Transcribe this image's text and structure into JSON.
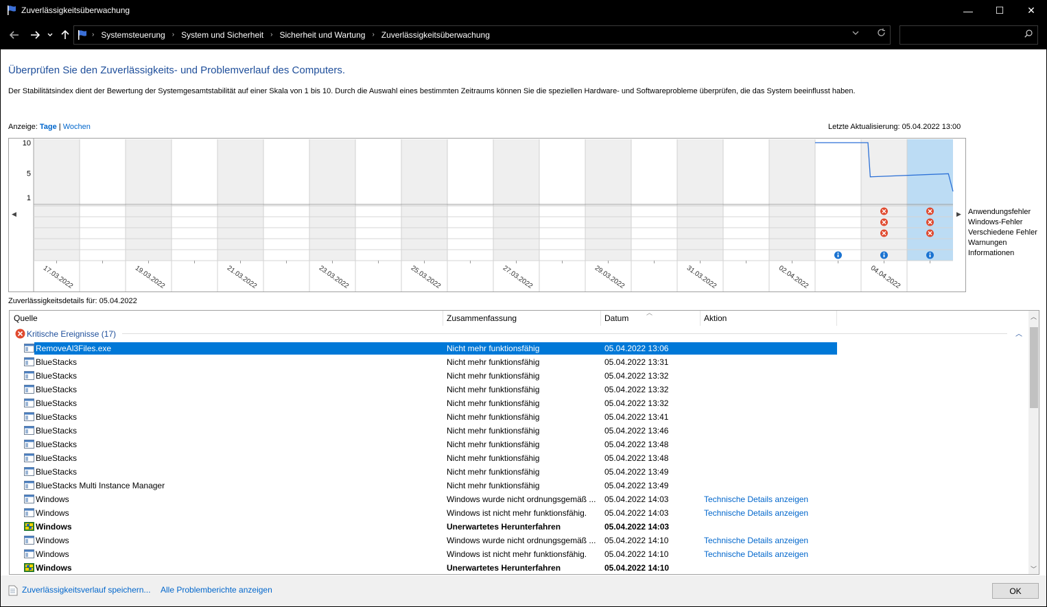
{
  "window": {
    "title": "Zuverlässigkeitsüberwachung",
    "minimize": "—",
    "maximize": "☐",
    "close": "✕"
  },
  "address": {
    "crumbs": [
      "Systemsteuerung",
      "System und Sicherheit",
      "Sicherheit und Wartung",
      "Zuverlässigkeitsüberwachung"
    ],
    "search_placeholder": ""
  },
  "page": {
    "heading": "Überprüfen Sie den Zuverlässigkeits- und Problemverlauf des Computers.",
    "description": "Der Stabilitätsindex dient der Bewertung der Systemgesamtstabilität auf einer Skala von 1 bis 10. Durch die Auswahl eines bestimmten Zeitraums können Sie die speziellen Hardware- und Softwareprobleme überprüfen, die das System beeinflusst haben.",
    "view_label": "Anzeige:",
    "view_days": "Tage",
    "view_sep": "|",
    "view_weeks": "Wochen",
    "last_update": "Letzte Aktualisierung: 05.04.2022 13:00",
    "details_label": "Zuverlässigkeitsdetails für: 05.04.2022"
  },
  "chart_data": {
    "type": "line",
    "title": "",
    "ylim": [
      1,
      10
    ],
    "y_ticks": [
      10,
      5,
      1
    ],
    "columns": 20,
    "selected_column": 19,
    "date_labels": [
      "17.03.2022",
      "19.03.2022",
      "21.03.2022",
      "23.03.2022",
      "25.03.2022",
      "27.03.2022",
      "29.03.2022",
      "31.03.2022",
      "02.04.2022",
      "04.04.2022"
    ],
    "series": [
      {
        "values": [
          {
            "x": 17.0,
            "y": 10.0
          },
          {
            "x": 18.15,
            "y": 10.0
          },
          {
            "x": 18.2,
            "y": 4.4
          },
          {
            "x": 19.9,
            "y": 4.9
          },
          {
            "x": 20.0,
            "y": 2.0
          }
        ]
      }
    ],
    "event_rows": [
      "Anwendungsfehler",
      "Windows-Fehler",
      "Verschiedene Fehler",
      "Warnungen",
      "Informationen"
    ],
    "events": [
      {
        "row": 0,
        "col": 18,
        "kind": "error"
      },
      {
        "row": 1,
        "col": 18,
        "kind": "error"
      },
      {
        "row": 2,
        "col": 18,
        "kind": "error"
      },
      {
        "row": 0,
        "col": 19,
        "kind": "error"
      },
      {
        "row": 1,
        "col": 19,
        "kind": "error"
      },
      {
        "row": 2,
        "col": 19,
        "kind": "error"
      },
      {
        "row": 4,
        "col": 17,
        "kind": "info"
      },
      {
        "row": 4,
        "col": 18,
        "kind": "info"
      },
      {
        "row": 4,
        "col": 19,
        "kind": "info"
      }
    ]
  },
  "list": {
    "headers": {
      "source": "Quelle",
      "summary": "Zusammenfassung",
      "date": "Datum",
      "action": "Aktion"
    },
    "group": "Kritische Ereignisse (17)",
    "rows": [
      {
        "icon": "app",
        "source": "RemoveAl3Files.exe",
        "summary": "Nicht mehr funktionsfähig",
        "date": "05.04.2022 13:06",
        "action": "",
        "selected": true
      },
      {
        "icon": "app",
        "source": "BlueStacks",
        "summary": "Nicht mehr funktionsfähig",
        "date": "05.04.2022 13:31",
        "action": ""
      },
      {
        "icon": "app",
        "source": "BlueStacks",
        "summary": "Nicht mehr funktionsfähig",
        "date": "05.04.2022 13:32",
        "action": ""
      },
      {
        "icon": "app",
        "source": "BlueStacks",
        "summary": "Nicht mehr funktionsfähig",
        "date": "05.04.2022 13:32",
        "action": ""
      },
      {
        "icon": "app",
        "source": "BlueStacks",
        "summary": "Nicht mehr funktionsfähig",
        "date": "05.04.2022 13:32",
        "action": ""
      },
      {
        "icon": "app",
        "source": "BlueStacks",
        "summary": "Nicht mehr funktionsfähig",
        "date": "05.04.2022 13:41",
        "action": ""
      },
      {
        "icon": "app",
        "source": "BlueStacks",
        "summary": "Nicht mehr funktionsfähig",
        "date": "05.04.2022 13:46",
        "action": ""
      },
      {
        "icon": "app",
        "source": "BlueStacks",
        "summary": "Nicht mehr funktionsfähig",
        "date": "05.04.2022 13:48",
        "action": ""
      },
      {
        "icon": "app",
        "source": "BlueStacks",
        "summary": "Nicht mehr funktionsfähig",
        "date": "05.04.2022 13:48",
        "action": ""
      },
      {
        "icon": "app",
        "source": "BlueStacks",
        "summary": "Nicht mehr funktionsfähig",
        "date": "05.04.2022 13:49",
        "action": ""
      },
      {
        "icon": "app",
        "source": "BlueStacks Multi Instance Manager",
        "summary": "Nicht mehr funktionsfähig",
        "date": "05.04.2022 13:49",
        "action": ""
      },
      {
        "icon": "app",
        "source": "Windows",
        "summary": "Windows wurde nicht ordnungsgemäß ...",
        "date": "05.04.2022 14:03",
        "action": "Technische Details anzeigen"
      },
      {
        "icon": "app",
        "source": "Windows",
        "summary": "Windows ist nicht mehr funktionsfähig.",
        "date": "05.04.2022 14:03",
        "action": "Technische Details anzeigen"
      },
      {
        "icon": "windows",
        "source": "Windows",
        "summary": "Unerwartetes Herunterfahren",
        "date": "05.04.2022 14:03",
        "action": "",
        "bold": true
      },
      {
        "icon": "app",
        "source": "Windows",
        "summary": "Windows wurde nicht ordnungsgemäß ...",
        "date": "05.04.2022 14:10",
        "action": "Technische Details anzeigen"
      },
      {
        "icon": "app",
        "source": "Windows",
        "summary": "Windows ist nicht mehr funktionsfähig.",
        "date": "05.04.2022 14:10",
        "action": "Technische Details anzeigen"
      },
      {
        "icon": "windows",
        "source": "Windows",
        "summary": "Unerwartetes Herunterfahren",
        "date": "05.04.2022 14:10",
        "action": "",
        "bold": true
      }
    ]
  },
  "footer": {
    "save_link": "Zuverlässigkeitsverlauf speichern...",
    "reports_link": "Alle Problemberichte anzeigen",
    "ok": "OK"
  },
  "colors": {
    "accent": "#0078d7",
    "heading": "#1e4e9a",
    "link": "#0066cc",
    "selected_column": "#bcdcf4",
    "error": "#e04a2f",
    "info": "#1a73d1"
  }
}
